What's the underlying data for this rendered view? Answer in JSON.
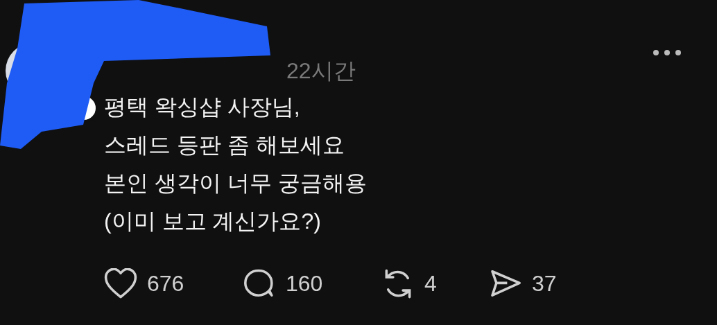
{
  "post": {
    "time": "22시간",
    "lines": [
      "평택 왁싱샵 사장님,",
      "스레드 등판 좀 해보세요",
      "본인 생각이 너무 궁금해용",
      "(이미 보고 계신가요?)"
    ],
    "actions": [
      {
        "kind": "like",
        "count": "676"
      },
      {
        "kind": "reply",
        "count": "160"
      },
      {
        "kind": "repost",
        "count": "4"
      },
      {
        "kind": "share",
        "count": "37"
      }
    ]
  }
}
